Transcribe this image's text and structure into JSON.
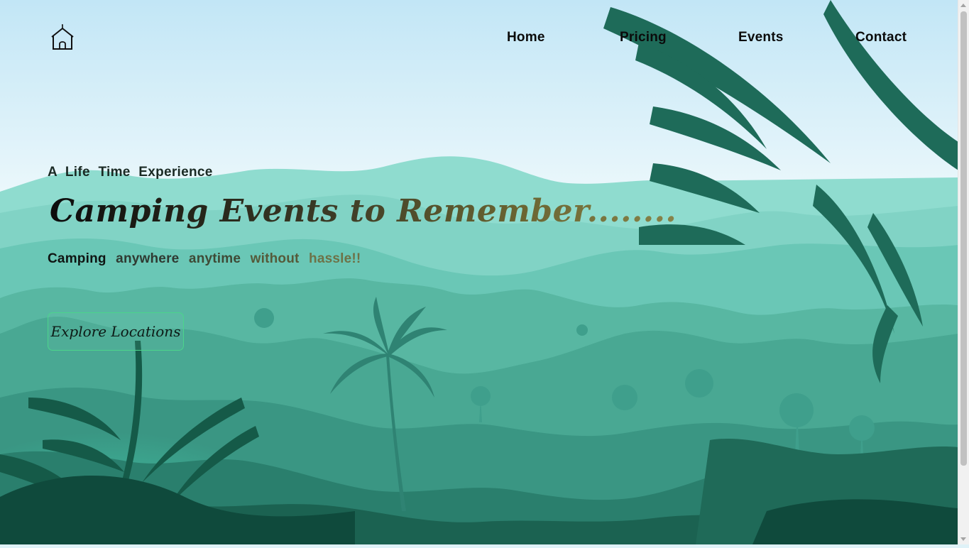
{
  "nav": {
    "home": "Home",
    "pricing": "Pricing",
    "events": "Events",
    "contact": "Contact"
  },
  "hero": {
    "tagline": "A Life Time Experience",
    "headline": "Camping Events to Remember........",
    "subline": [
      "Camping",
      "anywhere",
      "anytime",
      "without",
      "hassle!!"
    ],
    "cta_label": "Explore Locations"
  },
  "icons": {
    "logo": "house-icon"
  },
  "colors": {
    "sky_top": "#c2e6f6",
    "mountain_light": "#8fdccf",
    "forest_mid": "#3f9f8c",
    "forest_dark": "#145c4b",
    "cta_border": "#4cd48c"
  }
}
